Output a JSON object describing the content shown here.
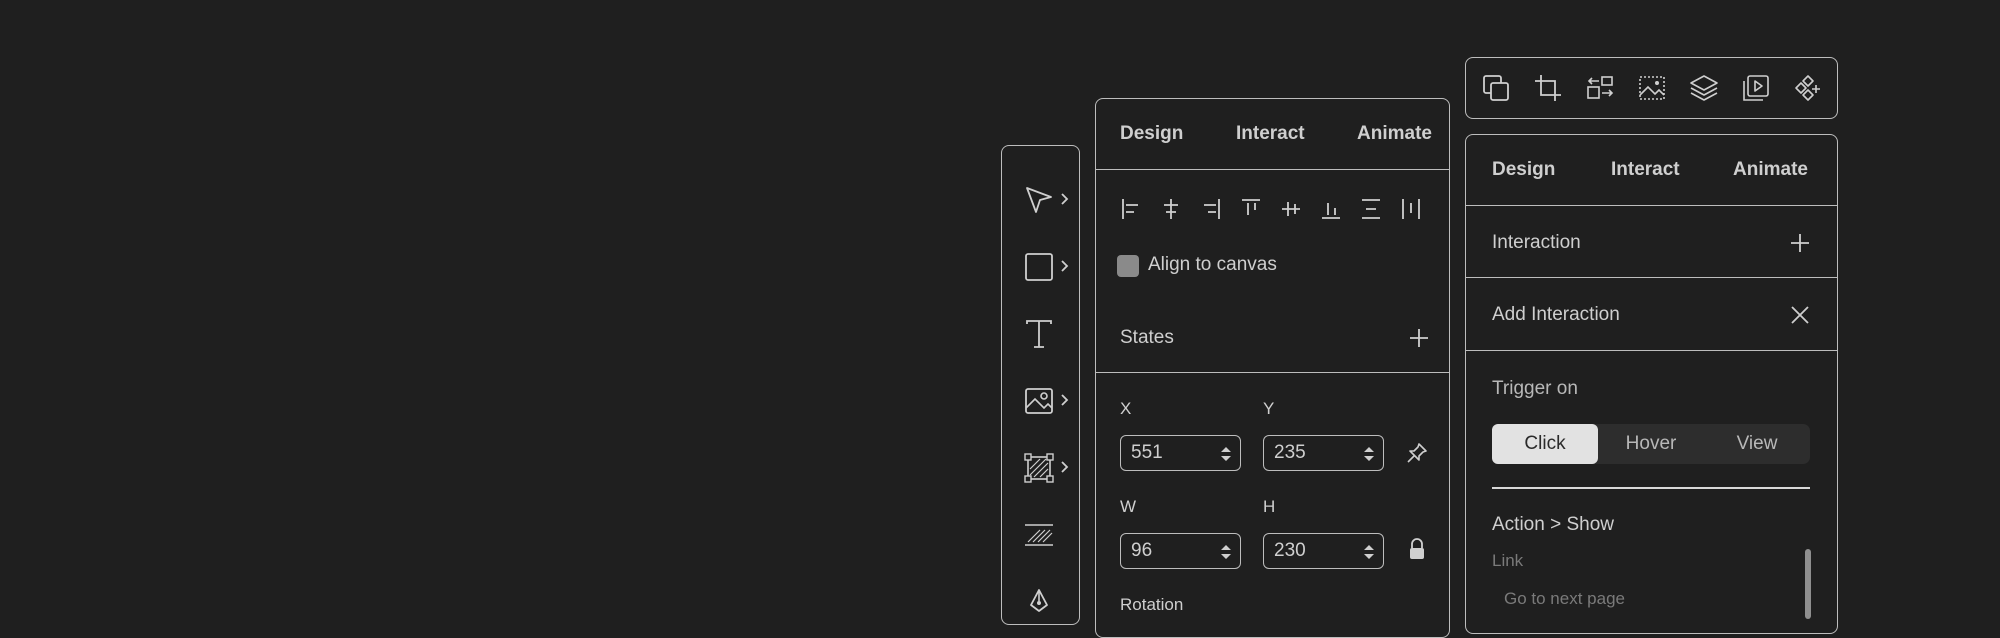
{
  "toolbar": {
    "tools": [
      "pointer-icon",
      "rectangle-icon",
      "text-icon",
      "image-icon",
      "frame-icon",
      "hatch-icon",
      "pen-icon"
    ]
  },
  "design_panel": {
    "tabs": [
      "Design",
      "Interact",
      "Animate"
    ],
    "align_to_canvas": "Align to canvas",
    "states_label": "States",
    "x_label": "X",
    "x_value": "551",
    "y_label": "Y",
    "y_value": "235",
    "w_label": "W",
    "w_value": "96",
    "h_label": "H",
    "h_value": "230",
    "rotation_label": "Rotation"
  },
  "icon_bar": {
    "icons": [
      "duplicate-icon",
      "crop-icon",
      "swap-icon",
      "image-fill-icon",
      "layers-icon",
      "play-preview-icon",
      "components-icon"
    ]
  },
  "interact_panel": {
    "tabs": [
      "Design",
      "Interact",
      "Animate"
    ],
    "interaction_label": "Interaction",
    "add_interaction_label": "Add Interaction",
    "trigger_on_label": "Trigger on",
    "triggers": [
      "Click",
      "Hover",
      "View"
    ],
    "active_trigger": "Click",
    "action_label": "Action > Show",
    "link_label": "Link",
    "link_placeholder": "Go to next page"
  },
  "colors": {
    "background": "#1f1f1f",
    "border": "#bdbdbd",
    "active_segment": "#e2e2e2"
  }
}
